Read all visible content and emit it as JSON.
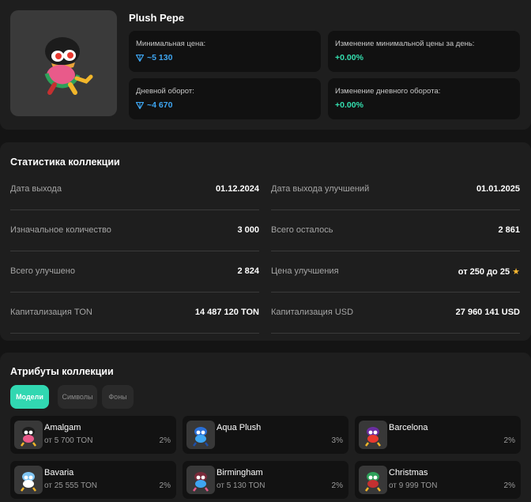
{
  "header": {
    "title": "Plush Pepe",
    "min_price": {
      "label": "Минимальная цена:",
      "value": "~5 130",
      "icon": "ton-icon"
    },
    "min_price_change": {
      "label": "Изменение минимальной цены за день:",
      "value": "+0.00%"
    },
    "daily_volume": {
      "label": "Дневной оборот:",
      "value": "~4 670",
      "icon": "ton-icon"
    },
    "daily_volume_change": {
      "label": "Изменение дневного оборота:",
      "value": "+0.00%"
    }
  },
  "stats": {
    "title": "Статистика коллекции",
    "rows": [
      {
        "label": "Дата выхода",
        "value": "01.12.2024"
      },
      {
        "label": "Дата выхода улучшений",
        "value": "01.01.2025"
      },
      {
        "label": "Изначальное количество",
        "value": "3 000"
      },
      {
        "label": "Всего осталось",
        "value": "2 861"
      },
      {
        "label": "Всего улучшено",
        "value": "2 824"
      },
      {
        "label": "Цена улучшения",
        "value": "от 250 до 25",
        "icon": "star-icon"
      },
      {
        "label": "Капитализация TON",
        "value": "14 487 120 TON"
      },
      {
        "label": "Капитализация USD",
        "value": "27 960 141 USD"
      }
    ]
  },
  "attributes": {
    "title": "Атрибуты коллекции",
    "tabs": [
      {
        "label": "Модели",
        "active": true
      },
      {
        "label": "Символы",
        "active": false
      },
      {
        "label": "Фоны",
        "active": false
      }
    ],
    "models": [
      {
        "name": "Amalgam",
        "price": "от 5 700 TON",
        "percent": "2%"
      },
      {
        "name": "Aqua Plush",
        "price": "",
        "percent": "3%"
      },
      {
        "name": "Barcelona",
        "price": "",
        "percent": "2%"
      },
      {
        "name": "Bavaria",
        "price": "от 25 555 TON",
        "percent": "2%"
      },
      {
        "name": "Birmingham",
        "price": "от 5 130 TON",
        "percent": "2%"
      },
      {
        "name": "Christmas",
        "price": "от 9 999 TON",
        "percent": "2%"
      }
    ]
  },
  "colors": {
    "accent": "#31d7b1",
    "ton_blue": "#3ea6f2",
    "positive": "#34e0b0",
    "star": "#f7b731"
  }
}
